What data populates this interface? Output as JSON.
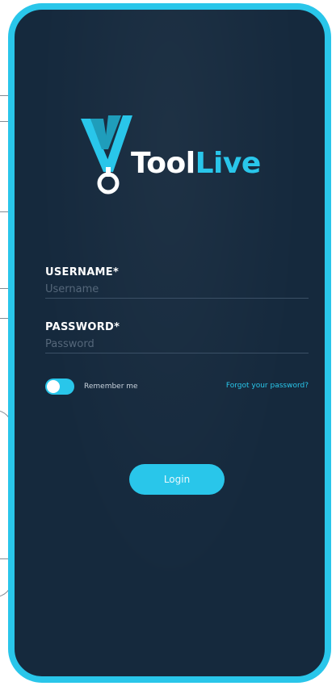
{
  "brand": {
    "name_part1": "Tool",
    "name_part2": "Live",
    "accent_color": "#29c6ea",
    "background_color": "#15293d",
    "logo_icon": "v-checkmark-pin-icon"
  },
  "form": {
    "username": {
      "label": "USERNAME*",
      "placeholder": "Username",
      "value": ""
    },
    "password": {
      "label": "PASSWORD*",
      "placeholder": "Password",
      "value": ""
    },
    "remember_me": {
      "label": "Remember me",
      "checked": false
    },
    "forgot_password_label": "Forgot your password?",
    "login_label": "Login"
  }
}
